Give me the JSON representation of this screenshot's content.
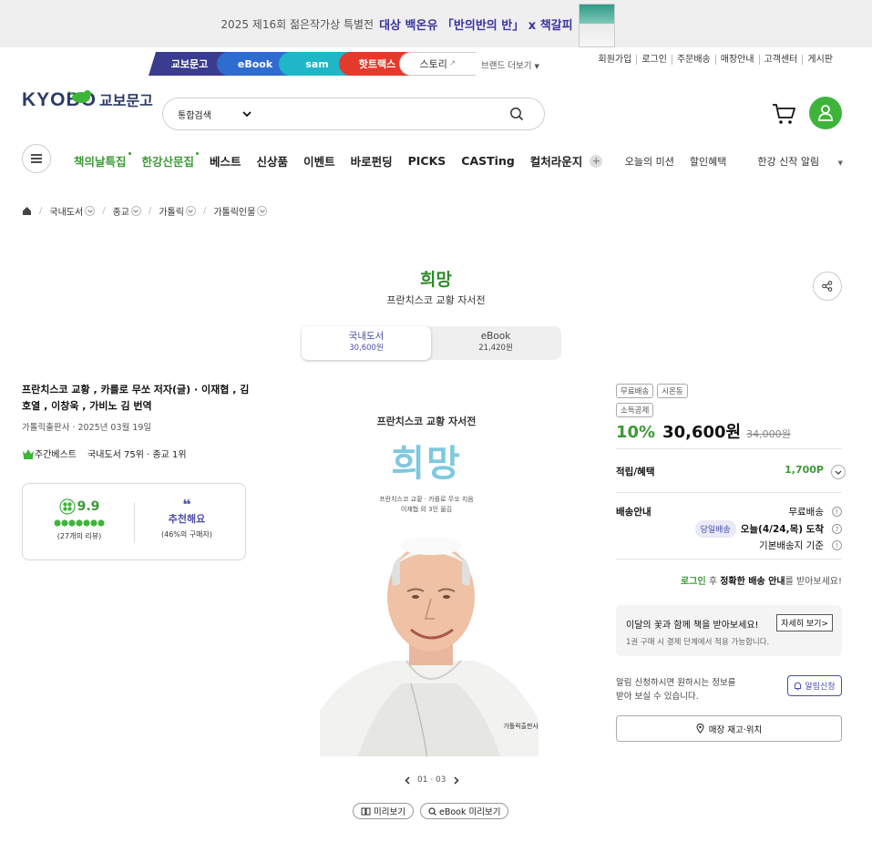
{
  "banner": {
    "text": "2025 제16회 젊은작가상 특별전",
    "highlight": "대상 백온유 「반의반의 반」 x 책갈피"
  },
  "brand_tabs": [
    {
      "label": "교보문고",
      "color": "#3a3c8f"
    },
    {
      "label": "eBook",
      "color": "#2f6ccf"
    },
    {
      "label": "sam",
      "color": "#1fb7c8"
    },
    {
      "label": "핫트랙스",
      "color": "#e43a2c"
    },
    {
      "label": "스토리",
      "color": "#ffffff"
    }
  ],
  "brand_more": "브랜드 더보기",
  "top_menu": [
    "회원가입",
    "로그인",
    "주문배송",
    "매장안내",
    "고객센터",
    "게시판"
  ],
  "logo": {
    "en": "KYOBO",
    "ko": "교보문고"
  },
  "search": {
    "type": "통합검색",
    "placeholder": ""
  },
  "gnb": [
    {
      "label": "책의날특집",
      "green": true,
      "dot": true
    },
    {
      "label": "한강산문집",
      "green": true,
      "dot": true
    },
    {
      "label": "베스트"
    },
    {
      "label": "신상품"
    },
    {
      "label": "이벤트"
    },
    {
      "label": "바로펀딩"
    },
    {
      "label": "PICKS"
    },
    {
      "label": "CASTing"
    },
    {
      "label": "컬처라운지"
    }
  ],
  "gnb_right": [
    "오늘의 미션",
    "할인혜택",
    "한강 신작 알림"
  ],
  "breadcrumb": [
    "국내도서",
    "종교",
    "가톨릭",
    "가톨릭인물"
  ],
  "product": {
    "title": "희망",
    "subtitle": "프란치스코 교황 자서전",
    "formats": [
      {
        "label": "국내도서",
        "price": "30,600원"
      },
      {
        "label": "eBook",
        "price": "21,420원"
      }
    ],
    "authors": "프란치스코 교황 , 카를로 무쏘 저자(글) · 이재협 , 김호열 , 이창욱 , 가비노 김 번역",
    "publisher": "가톨릭출판사 · 2025년 03월 19일",
    "rank_label": "주간베스트",
    "rank": "국내도서 75위 · 종교 1위",
    "review_score": "9.9",
    "review_count": "(27개의 리뷰)",
    "recommend": "추천해요",
    "recommend_pct": "(46%의 구매자)"
  },
  "cover": {
    "subtitle": "프란치스코 교황 자서전",
    "title": "희망",
    "credit1": "프란치스코 교황 · 카를로 무쏘 지음",
    "credit2": "이재협 외 3인 옮김",
    "publisher": "가톨릭출판사"
  },
  "pager": "01 · 03",
  "preview": [
    "미리보기",
    "eBook 미리보기"
  ],
  "side": {
    "badges": [
      "무료배송",
      "시온동",
      "소득공제"
    ],
    "discount": "10%",
    "price": "30,600원",
    "original": "34,000원",
    "points_label": "적립/혜택",
    "points": "1,700P",
    "delivery_label": "배송안내",
    "free_ship": "무료배송",
    "today_tag": "당일배송",
    "arrival": "오늘(4/24,목) 도착",
    "base_ship": "기본배송지 기준",
    "login_link": "로그인",
    "login_mid": "후",
    "login_bold": "정확한 배송 안내",
    "login_tail": "를 받아보세요!",
    "flower_title": "이달의 꽃과 함께 책을 받아보세요!",
    "flower_btn": "자세히 보기>",
    "flower_sub": "1권 구매 시 결제 단계에서 적용 가능합니다.",
    "alarm_text1": "알림 신청하시면 원하시는 정보를",
    "alarm_text2": "받아 보실 수 있습니다.",
    "alarm_btn": "알림신청",
    "store_btn": "매장 재고·위치"
  }
}
